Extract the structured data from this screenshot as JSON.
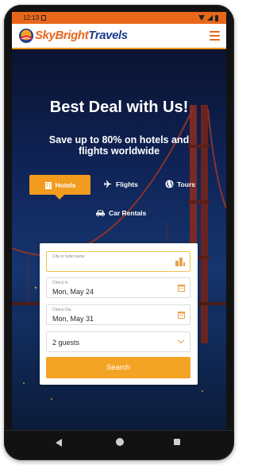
{
  "statusbar": {
    "time": "12:13"
  },
  "app": {
    "brand_sky": "Sky",
    "brand_bright": "Bright",
    "brand_travels": "Travels"
  },
  "hero": {
    "title": "Best Deal with Us!",
    "subtitle": "Save up to 80% on hotels and flights worldwide"
  },
  "tabs": [
    {
      "label": "Hotels",
      "icon": "hotel-icon",
      "active": true
    },
    {
      "label": "Flights",
      "icon": "plane-icon",
      "active": false
    },
    {
      "label": "Tours",
      "icon": "globe-icon",
      "active": false
    },
    {
      "label": "Car Rentals",
      "icon": "car-icon",
      "active": false
    }
  ],
  "form": {
    "destination": {
      "placeholder": "City or hotel name",
      "value": ""
    },
    "check_in": {
      "label": "Check In",
      "value": "Mon, May 24"
    },
    "check_out": {
      "label": "Check Out",
      "value": "Mon, May 31"
    },
    "guests": {
      "value": "2 guests"
    },
    "search_label": "Search"
  },
  "colors": {
    "accent": "#f29b1f",
    "brand_orange": "#e8671b",
    "brand_blue": "#1d3b8a"
  }
}
